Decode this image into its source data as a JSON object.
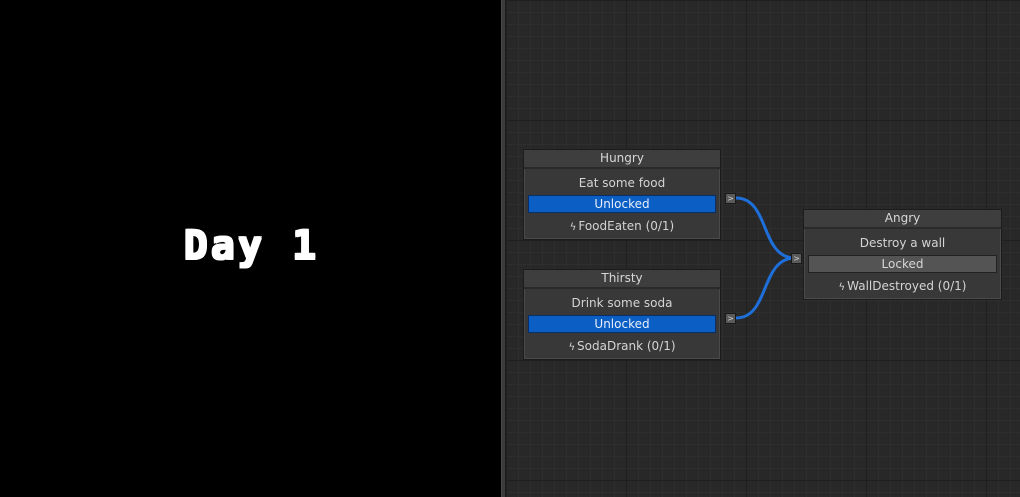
{
  "game": {
    "day_label": "Day 1"
  },
  "graph": {
    "wire_color": "#1e6fd9",
    "nodes": [
      {
        "id": "hungry",
        "title": "Hungry",
        "description": "Eat some food",
        "status": "Unlocked",
        "event": "FoodEaten (0/1)"
      },
      {
        "id": "thirsty",
        "title": "Thirsty",
        "description": "Drink some soda",
        "status": "Unlocked",
        "event": "SodaDrank (0/1)"
      },
      {
        "id": "angry",
        "title": "Angry",
        "description": "Destroy a wall",
        "status": "Locked",
        "event": "WallDestroyed (0/1)"
      }
    ],
    "port_glyph": ">",
    "event_icon": "lightning-bolt-icon"
  }
}
